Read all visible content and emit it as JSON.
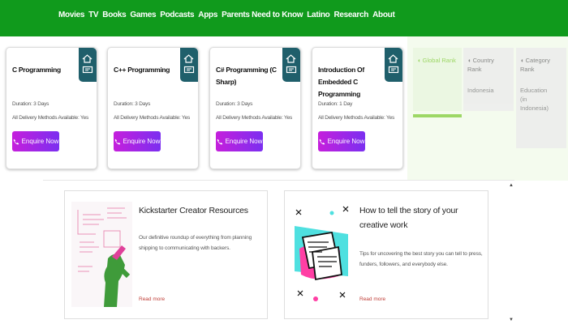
{
  "nav": {
    "links": [
      "Movies",
      "TV",
      "Books",
      "Games",
      "Podcasts",
      "Apps",
      "Parents Need to Know",
      "Latino",
      "Research",
      "About"
    ]
  },
  "courses": [
    {
      "title": "C Programming",
      "duration": "Duration: 3 Days",
      "delivery": "All Delivery Methods Available: Yes",
      "button": "Enquire Now"
    },
    {
      "title": "C++ Programming",
      "duration": "Duration: 3 Days",
      "delivery": "All Delivery Methods Available: Yes",
      "button": "Enquire Now"
    },
    {
      "title": "C# Programming (C Sharp)",
      "duration": "Duration: 3 Days",
      "delivery": "All Delivery Methods Available: Yes",
      "button": "Enquire Now"
    },
    {
      "title": "Introduction Of Embedded C Programming",
      "duration": "Duration: 1 Day",
      "delivery": "All Delivery Methods Available: Yes",
      "button": "Enquire Now"
    }
  ],
  "ranks": {
    "global": "Global Rank",
    "country": "Country Rank",
    "country_value": "Indonesia",
    "category": "Category Rank",
    "category_value": "Education (in Indonesia)"
  },
  "resources": [
    {
      "title": "Kickstarter Creator Resources",
      "description": "Our definitive roundup of everything from planning shipping to communicating with backers.",
      "more": "Read more"
    },
    {
      "title": "How to tell the story of your creative work",
      "description": "Tips for uncovering the best story you can tell to press, funders, followers, and everybody else.",
      "more": "Read more"
    }
  ],
  "colors": {
    "nav_bg": "#109a1c",
    "corner": "#1f5f6b",
    "button_gradient_start": "#c51fdc",
    "button_gradient_end": "#7b2ff0",
    "read_more": "#c0403a"
  }
}
